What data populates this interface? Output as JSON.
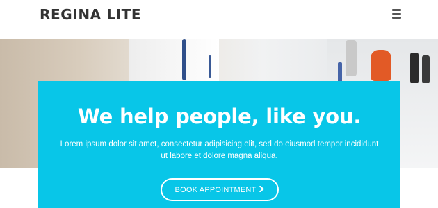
{
  "header": {
    "logo": "REGINA LITE",
    "menu_icon": "hamburger-menu-icon"
  },
  "hero": {
    "title": "We help people, like you.",
    "subtitle_line1": "Lorem ipsum dolor sit amet, consectetur adipisicing elit, sed do eiusmod tempor incididunt",
    "subtitle_line2": "ut labore et dolore magna aliqua.",
    "cta_label": "BOOK APPOINTMENT",
    "cta_icon": "chevron-right-icon",
    "accent_color": "#08c6e8"
  }
}
